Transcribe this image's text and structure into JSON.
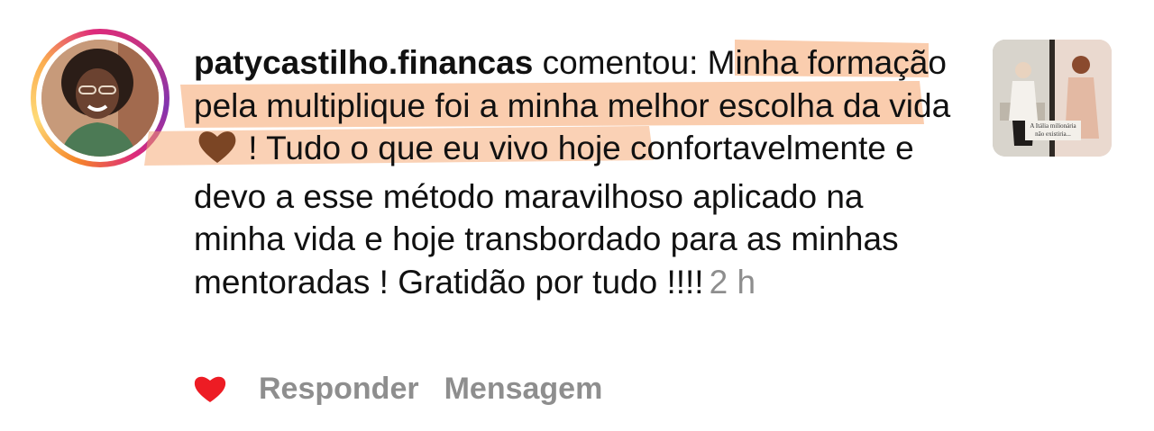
{
  "comment": {
    "username": "patycastilho.financas",
    "text_before_emoji": " comentou: Minha formação pela multiplique foi a minha melhor escolha da vida",
    "emoji": "brown-heart-emoji",
    "text_after_emoji": " ! Tudo o que eu vivo hoje confortavelmente e devo a esse método maravilhoso aplicado na minha vida e hoje transbordado para as minhas mentoradas ! Gratidão por tudo !!!!",
    "timestamp": "2 h"
  },
  "post_thumbnail": {
    "caption": "A Itália milionária não existiria..."
  },
  "actions": {
    "like_icon": "heart-icon",
    "reply_label": "Responder",
    "message_label": "Mensagem"
  },
  "colors": {
    "like_red": "#ed1c24",
    "secondary_text": "#8e8e8e",
    "highlight_orange": "#f5a46b",
    "emoji_brown": "#7b4524"
  }
}
